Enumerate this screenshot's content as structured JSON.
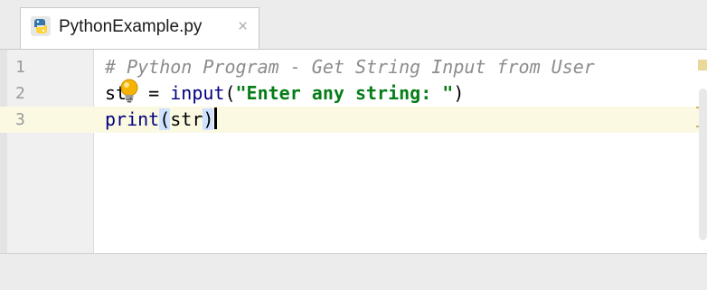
{
  "tab": {
    "title": "PythonExample.py",
    "close": "×",
    "icon": "python-file-icon"
  },
  "editor": {
    "lines": [
      {
        "number": "1",
        "comment": "# Python Program - Get String Input from User"
      },
      {
        "number": "2",
        "var": "str",
        "assign": " = ",
        "func": "input",
        "open": "(",
        "string": "\"Enter any string: \"",
        "close": ")"
      },
      {
        "number": "3",
        "func": "print",
        "open": "(",
        "arg": "str",
        "close": ")"
      }
    ],
    "current_line": 3,
    "intention_icon": "lightbulb-icon"
  },
  "colors": {
    "comment": "#8c8c8c",
    "string": "#067d17",
    "current_line_bg": "#fcf9e3",
    "paren_highlight": "#cfe2ff"
  }
}
